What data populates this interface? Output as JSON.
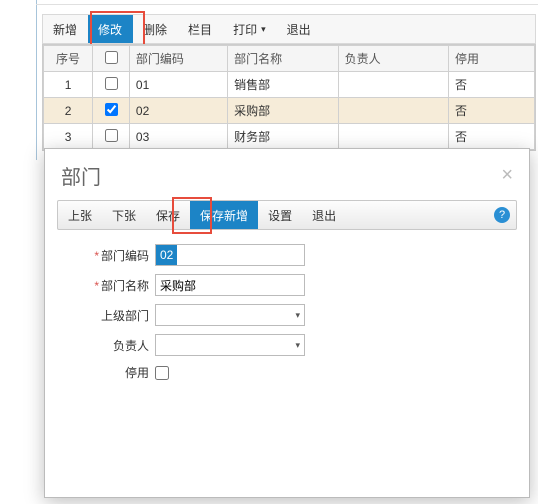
{
  "toolbar": {
    "add": "新增",
    "edit": "修改",
    "delete": "删除",
    "column": "栏目",
    "print": "打印",
    "exit": "退出"
  },
  "grid": {
    "cols": {
      "seq": "序号",
      "code": "部门编码",
      "name": "部门名称",
      "owner": "负责人",
      "disabled": "停用"
    },
    "rows": [
      {
        "seq": "1",
        "checked": false,
        "code": "01",
        "name": "销售部",
        "owner": "",
        "disabled": "否"
      },
      {
        "seq": "2",
        "checked": true,
        "code": "02",
        "name": "采购部",
        "owner": "",
        "disabled": "否"
      },
      {
        "seq": "3",
        "checked": false,
        "code": "03",
        "name": "财务部",
        "owner": "",
        "disabled": "否"
      }
    ]
  },
  "dialog": {
    "title": "部门",
    "toolbar": {
      "prev": "上张",
      "next": "下张",
      "save": "保存",
      "saveNew": "保存新增",
      "settings": "设置",
      "exit": "退出"
    },
    "form": {
      "codeLabel": "部门编码",
      "codeValue": "02",
      "nameLabel": "部门名称",
      "nameValue": "采购部",
      "parentLabel": "上级部门",
      "ownerLabel": "负责人",
      "disabledLabel": "停用"
    }
  }
}
